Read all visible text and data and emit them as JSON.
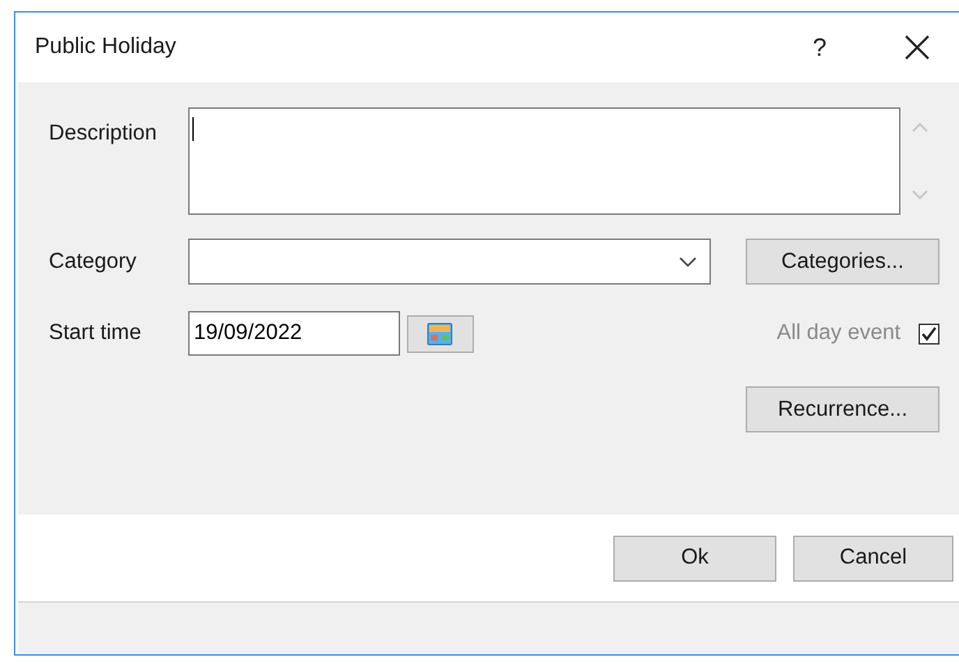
{
  "window": {
    "title": "Public Holiday",
    "help": "?"
  },
  "description": {
    "label": "Description"
  },
  "category": {
    "label": "Category",
    "button": "Categories..."
  },
  "start_time": {
    "label": "Start time",
    "value": "19/09/2022"
  },
  "all_day_event": {
    "label": "All day event",
    "checked": true,
    "disabled": true
  },
  "recurrence_button": "Recurrence...",
  "buttons": [
    {
      "label": "Ok"
    },
    {
      "label": "Cancel"
    }
  ]
}
